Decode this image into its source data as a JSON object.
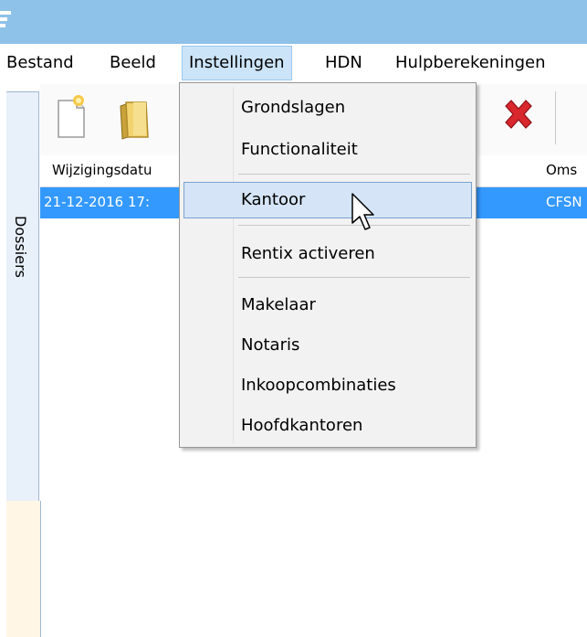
{
  "menubar": {
    "items": [
      {
        "label": "Bestand"
      },
      {
        "label": "Beeld"
      },
      {
        "label": "Instellingen"
      },
      {
        "label": "HDN"
      },
      {
        "label": "Hulpberekeningen"
      }
    ],
    "active": "Instellingen"
  },
  "toolbar": {
    "buttons": [
      "new-document-icon",
      "open-folder-icon",
      "delete-icon"
    ]
  },
  "dock": {
    "tab_label": "Dossiers"
  },
  "grid": {
    "headers": [
      "Wijzigingsdatu",
      "Oms"
    ],
    "rows": [
      {
        "date": "21-12-2016 17:",
        "omschrijving": "CFSN"
      }
    ]
  },
  "dropdown": {
    "items": [
      {
        "label": "Grondslagen"
      },
      {
        "label": "Functionaliteit"
      },
      {
        "label": "Kantoor"
      },
      {
        "label": "Rentix activeren"
      },
      {
        "label": "Makelaar"
      },
      {
        "label": "Notaris"
      },
      {
        "label": "Inkoopcombinaties"
      },
      {
        "label": "Hoofdkantoren"
      }
    ],
    "highlighted": "Kantoor"
  },
  "colors": {
    "titlebar": "#8ec2e8",
    "selection": "#3399ff",
    "menu_highlight": "#d5e5f7"
  }
}
